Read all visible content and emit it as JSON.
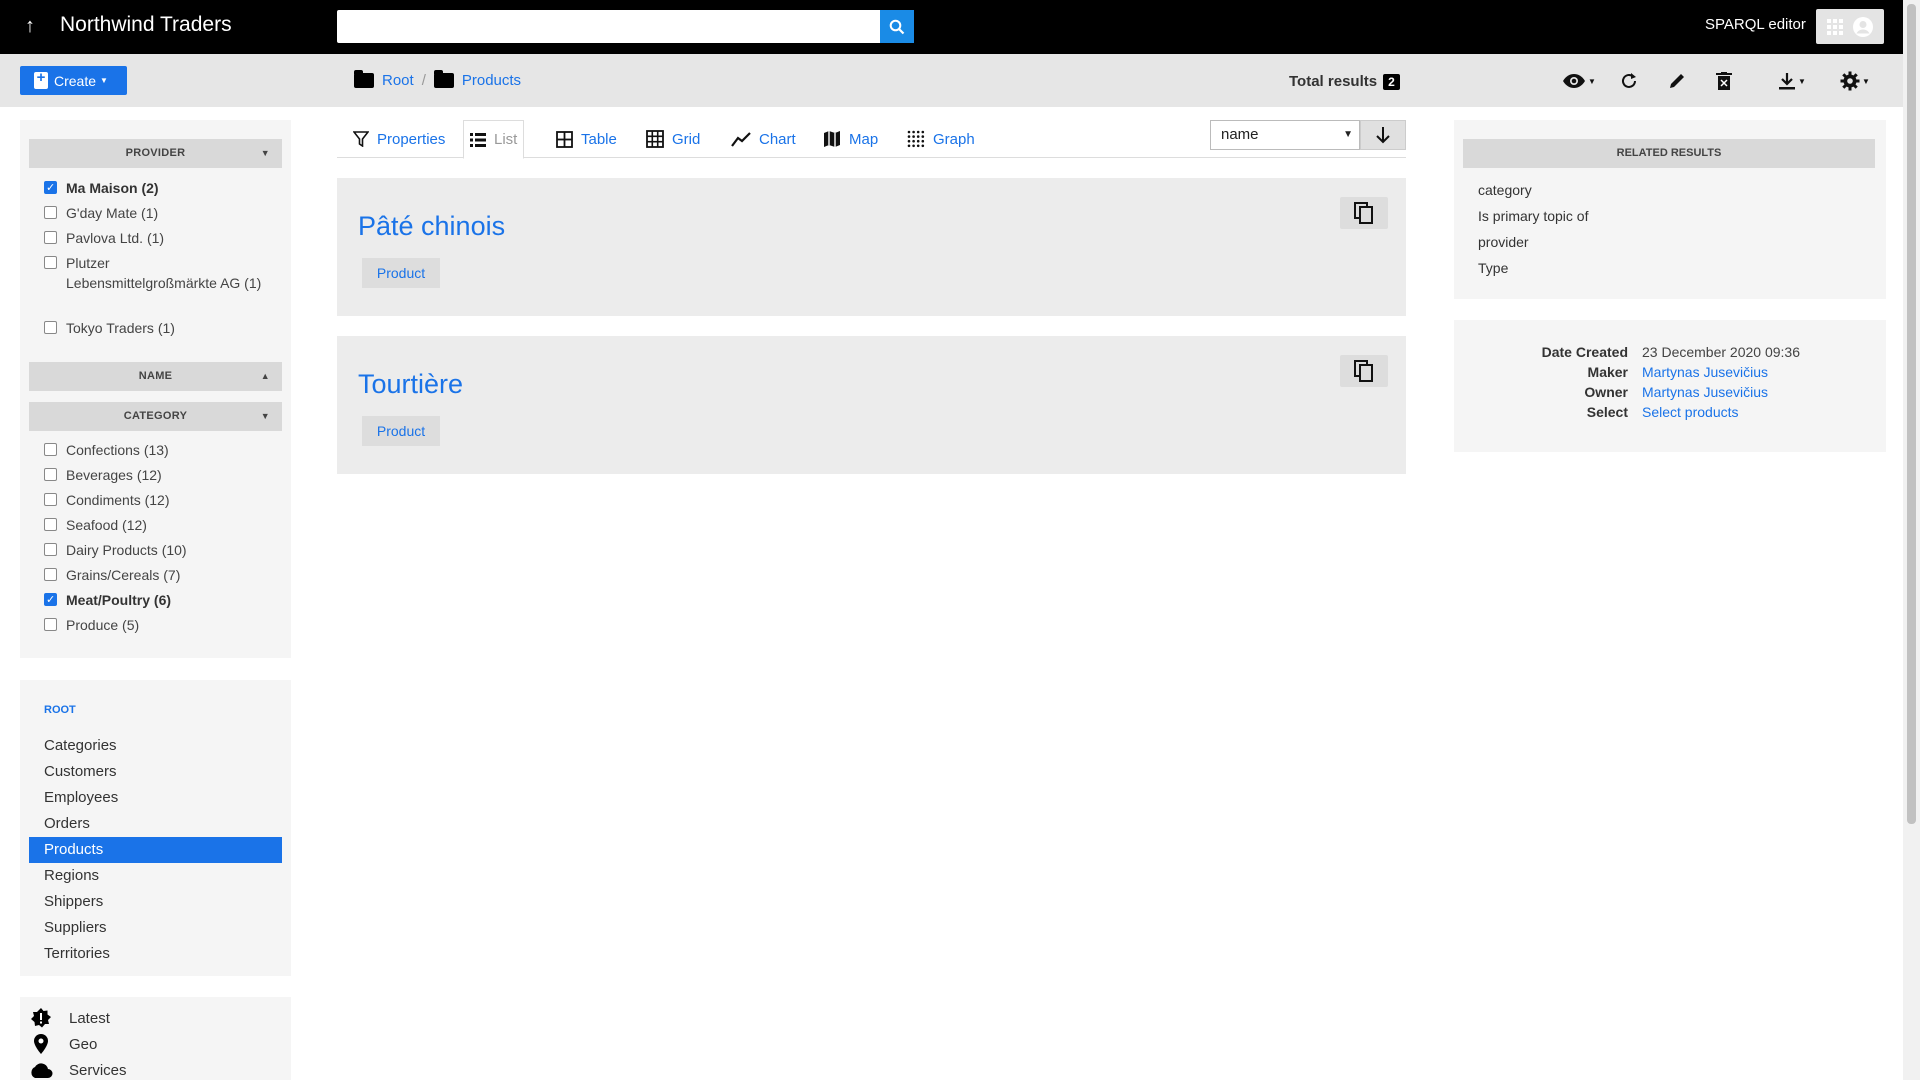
{
  "navbar": {
    "brand": "Northwind Traders",
    "search_placeholder": "",
    "sparql": "SPARQL editor"
  },
  "actionbar": {
    "create": "Create",
    "breadcrumb": [
      "Root",
      "Products"
    ],
    "total_label": "Total results",
    "total_count": "2"
  },
  "facets": {
    "provider": {
      "title": "PROVIDER",
      "items": [
        {
          "label": "Ma Maison (2)",
          "checked": true
        },
        {
          "label": "G'day Mate (1)",
          "checked": false
        },
        {
          "label": "Pavlova Ltd. (1)",
          "checked": false
        },
        {
          "label": "Plutzer Lebensmittelgroßmärkte AG (1)",
          "checked": false
        },
        {
          "label": "Tokyo Traders (1)",
          "checked": false
        }
      ]
    },
    "name": {
      "title": "NAME"
    },
    "category": {
      "title": "CATEGORY",
      "items": [
        {
          "label": "Confections (13)",
          "checked": false
        },
        {
          "label": "Beverages (12)",
          "checked": false
        },
        {
          "label": "Condiments (12)",
          "checked": false
        },
        {
          "label": "Seafood (12)",
          "checked": false
        },
        {
          "label": "Dairy Products (10)",
          "checked": false
        },
        {
          "label": "Grains/Cereals (7)",
          "checked": false
        },
        {
          "label": "Meat/Poultry (6)",
          "checked": true
        },
        {
          "label": "Produce (5)",
          "checked": false
        }
      ]
    }
  },
  "rootnav": {
    "title": "ROOT",
    "items": [
      "Categories",
      "Customers",
      "Employees",
      "Orders",
      "Products",
      "Regions",
      "Shippers",
      "Suppliers",
      "Territories"
    ],
    "active": "Products"
  },
  "bottomnav": {
    "items": [
      "Latest",
      "Geo",
      "Services"
    ]
  },
  "tabs": [
    "Properties",
    "List",
    "Table",
    "Grid",
    "Chart",
    "Map",
    "Graph"
  ],
  "active_tab": "List",
  "sort": {
    "value": "name"
  },
  "results": [
    {
      "title": "Pâté chinois",
      "type": "Product"
    },
    {
      "title": "Tourtière",
      "type": "Product"
    }
  ],
  "related": {
    "title": "RELATED RESULTS",
    "items": [
      "category",
      "Is primary topic of",
      "provider",
      "Type"
    ]
  },
  "meta": {
    "date_created_label": "Date Created",
    "date_created": "23 December 2020 09:36",
    "maker_label": "Maker",
    "maker": "Martynas Jusevičius",
    "owner_label": "Owner",
    "owner": "Martynas Jusevičius",
    "select_label": "Select",
    "select": "Select products"
  },
  "colors": {
    "accent": "#1a73e8",
    "navbar": "#000000"
  }
}
